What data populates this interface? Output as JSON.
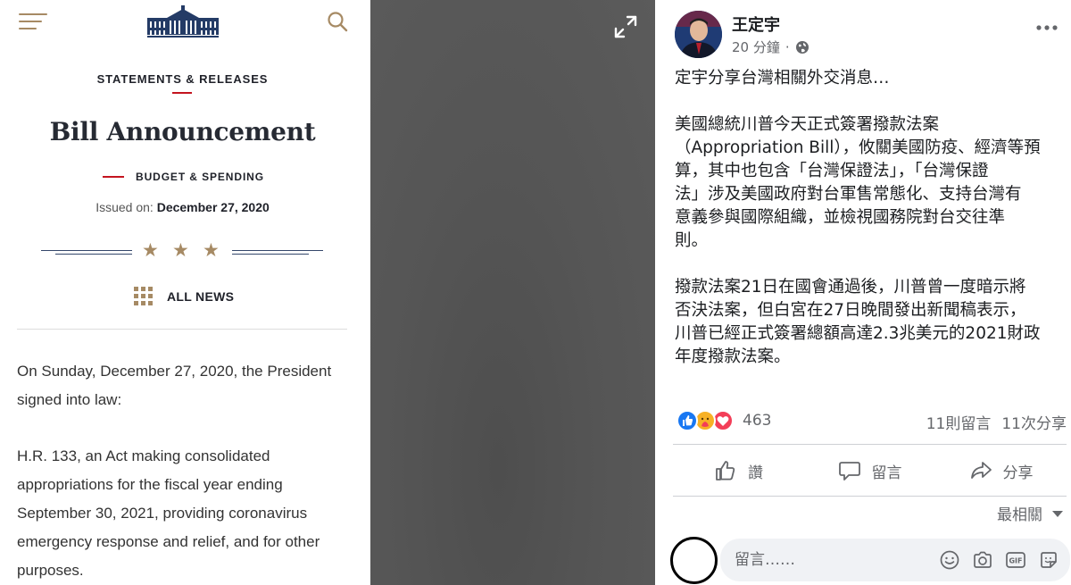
{
  "whitehouse": {
    "section": "STATEMENTS & RELEASES",
    "title": "Bill Announcement",
    "category": "BUDGET & SPENDING",
    "issued_label": "Issued on:",
    "issued_date": "December 27, 2020",
    "all_news": "ALL NEWS",
    "paragraphs": [
      "On Sunday, December 27, 2020, the President signed into law:",
      "H.R. 133, an Act making consolidated appropriations for the fiscal year ending September 30, 2021, providing coronavirus emergency response and relief, and for other purposes."
    ],
    "colors": {
      "gold": "#a68a64",
      "red": "#c4141f",
      "navy": "#34476b"
    }
  },
  "media": {
    "expand_icon": "expand-icon"
  },
  "facebook": {
    "author": "王定宇",
    "time": "20 分鐘",
    "separator": "·",
    "paragraphs": [
      "定宇分享台灣相關外交消息…",
      "美國總統川普今天正式簽署撥款法案\n（Appropriation Bill），攸關美國防疫、經濟等預\n算，其中也包含「台灣保證法」，「台灣保證\n法」涉及美國政府對台軍售常態化、支持台灣有\n意義參與國際組織，並檢視國務院對台交往準\n則。",
      "撥款法案21日在國會通過後，川普曾一度暗示將\n否決法案，但白宮在27日晚間發出新聞稿表示，\n川普已經正式簽署總額高達2.3兆美元的2021財政\n年度撥款法案。"
    ],
    "reaction_count": "463",
    "comments": "11則留言",
    "shares": "11次分享",
    "actions": {
      "like": "讚",
      "comment": "留言",
      "share": "分享"
    },
    "sort": "最相關",
    "comment_placeholder": "留言……",
    "colors": {
      "like_blue": "#1877f2",
      "love_red": "#f33e58",
      "care_yellow": "#f7b125",
      "text_gray": "#65676b"
    }
  }
}
